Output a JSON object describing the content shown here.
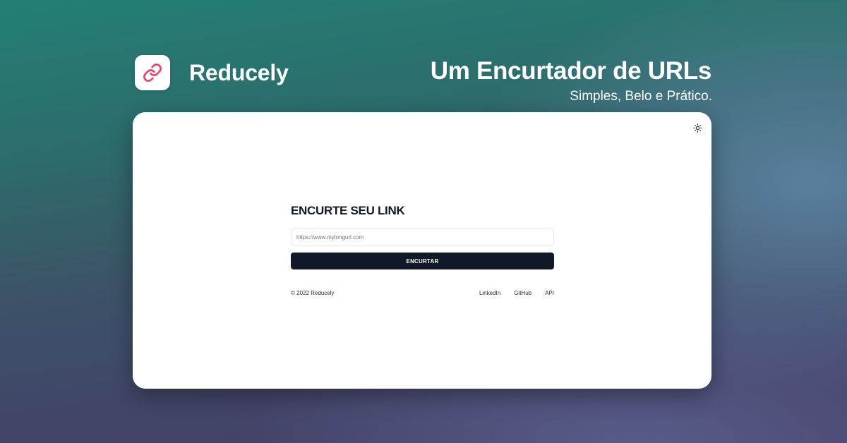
{
  "brand": {
    "name": "Reducely",
    "logo_icon": "link-icon",
    "logo_color": "#ef4466"
  },
  "hero": {
    "headline": "Um Encurtador de URLs",
    "tagline": "Simples, Belo e Prático."
  },
  "app": {
    "theme_toggle_icon": "sun-icon",
    "title": "ENCURTE SEU LINK",
    "input": {
      "placeholder": "https://www.mylongurl.com",
      "value": ""
    },
    "submit_label": "ENCURTAR",
    "footer": {
      "copyright": "© 2022 Reducely",
      "links": [
        {
          "label": "LinkedIn"
        },
        {
          "label": "GitHub"
        },
        {
          "label": "API"
        }
      ]
    }
  },
  "colors": {
    "button_bg": "#111827",
    "accent": "#ef4466"
  }
}
